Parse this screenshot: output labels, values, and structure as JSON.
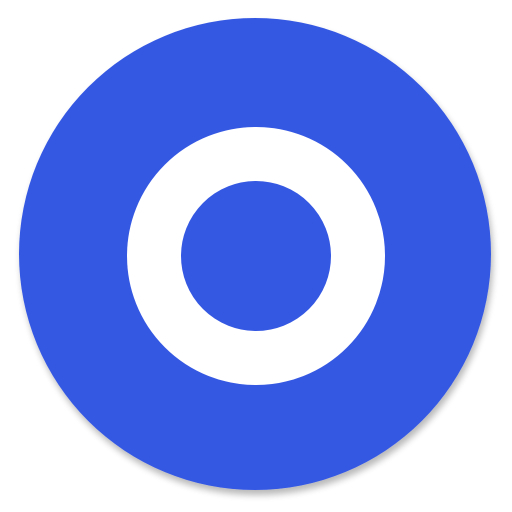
{
  "icon": {
    "name": "ring-icon",
    "background_color": "#3558E3",
    "ring_color": "#FFFFFF",
    "shadow_color": "#000000"
  }
}
